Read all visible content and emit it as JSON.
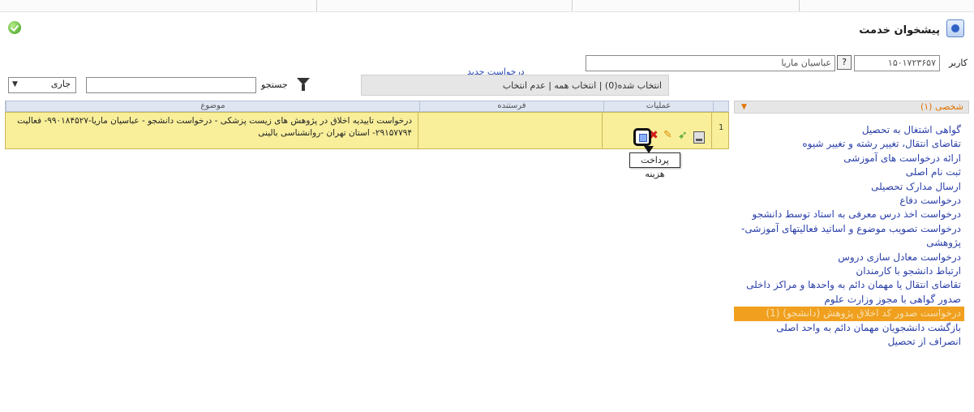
{
  "page": {
    "title": "پیشخوان خدمت",
    "user_label": "کاربر",
    "user_id": "۱۵۰۱۷۲۳۶۵۷",
    "user_name": "عباسیان ماریا",
    "help_button": "?",
    "new_request_link": "درخواست جدید"
  },
  "toolbar": {
    "selection_text": "انتخاب شده(0) | انتخاب همه | عدم انتخاب",
    "search_label": "جستجو",
    "search_value": "",
    "status_select": "جاری"
  },
  "grid": {
    "headers": {
      "actions": "عملیات",
      "sender": "فرستنده",
      "subject": "موضوع"
    },
    "rows": [
      {
        "num": "1",
        "subject": "درخواست تاییدیه اخلاق در پژوهش های زیست پزشکی - درخواست دانشجو - عباسیان ماریا-۹۹۰۱۸۴۵۲۷- فعالیت ۲۹۱۵۷۷۹۴- استان تهران -روانشناسی بالینی",
        "sender": ""
      }
    ],
    "tooltip": "پرداخت هزینه"
  },
  "sidebar": {
    "header": "شخصی (۱)",
    "items": [
      "گواهی اشتغال به تحصیل",
      "تقاضای انتقال، تغییر رشته و تغییر شیوه",
      "ارائه درخواست های آموزشی",
      "ثبت نام اصلی",
      "ارسال مدارک تحصیلی",
      "درخواست دفاع",
      "درخواست اخذ درس معرفی به استاد توسط دانشجو",
      "درخواست تصویب موضوع و اساتید فعالیتهای آموزشی-پژوهشی",
      "درخواست معادل سازی دروس",
      "ارتباط دانشجو با کارمندان",
      "تقاضای انتقال یا مهمان دائم به واحدها و مراکز داخلی",
      "صدور گواهی با مجوز وزارت علوم",
      "درخواست صدور کد اخلاق پژوهش (دانشجو) (1)",
      "بازگشت دانشجویان مهمان دائم به واحد اصلی",
      "انصراف از تحصیل"
    ],
    "active_index": 12
  },
  "colors": {
    "row_highlight": "#f9ef9a",
    "active_menu": "#f0a01e",
    "link": "#2a3fa8"
  }
}
